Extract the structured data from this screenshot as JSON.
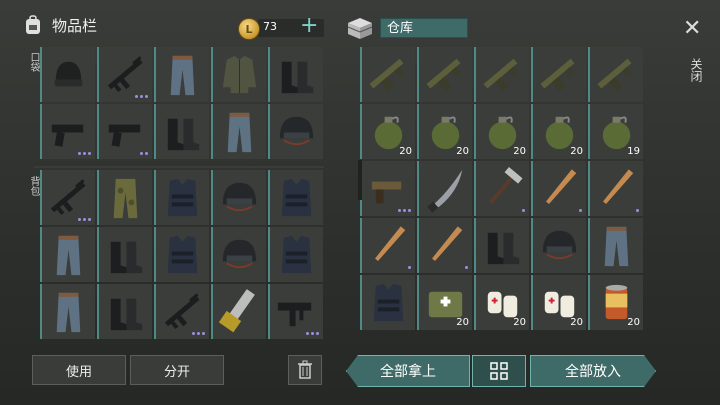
{
  "inventory": {
    "title": "物品栏",
    "pocket_label": "口袋",
    "backpack_label": "背包"
  },
  "currency": {
    "icon": "coin-icon",
    "symbol": "L",
    "amount": "73"
  },
  "storage": {
    "title": "仓库"
  },
  "close": {
    "label": "关闭"
  },
  "buttons": {
    "use": "使用",
    "split": "分开",
    "take_all": "全部拿上",
    "put_all": "全部放入"
  },
  "pockets": [
    {
      "icon": "beanie-icon"
    },
    {
      "icon": "rifle-icon",
      "dots": 3
    },
    {
      "icon": "pants-icon"
    },
    {
      "icon": "jacket-icon"
    },
    {
      "icon": "boots-icon"
    },
    {
      "icon": "pistol-icon",
      "dots": 3
    },
    {
      "icon": "pistol-icon",
      "dots": 2
    },
    {
      "icon": "boots-icon"
    },
    {
      "icon": "pants-icon"
    },
    {
      "icon": "helmet-icon"
    }
  ],
  "backpack": [
    {
      "icon": "rifle-icon",
      "dots": 3
    },
    {
      "icon": "camo-pants-icon"
    },
    {
      "icon": "vest-icon"
    },
    {
      "icon": "helmet-icon"
    },
    {
      "icon": "vest-icon"
    },
    {
      "icon": "pants-icon"
    },
    {
      "icon": "boots-icon"
    },
    {
      "icon": "vest-icon"
    },
    {
      "icon": "helmet-icon"
    },
    {
      "icon": "vest-icon"
    },
    {
      "icon": "pants-icon"
    },
    {
      "icon": "boots-icon"
    },
    {
      "icon": "rifle-icon",
      "dots": 3
    },
    {
      "icon": "chainsaw-icon"
    },
    {
      "icon": "smg-icon",
      "dots": 3
    }
  ],
  "storage_items": [
    {
      "icon": "grenade-launcher-icon"
    },
    {
      "icon": "grenade-launcher-icon"
    },
    {
      "icon": "grenade-launcher-icon"
    },
    {
      "icon": "grenade-launcher-icon"
    },
    {
      "icon": "grenade-launcher-icon"
    },
    {
      "icon": "grenade-icon",
      "count": "20"
    },
    {
      "icon": "grenade-icon",
      "count": "20"
    },
    {
      "icon": "grenade-icon",
      "count": "20"
    },
    {
      "icon": "grenade-icon",
      "count": "20"
    },
    {
      "icon": "grenade-icon",
      "count": "19"
    },
    {
      "icon": "flare-gun-icon",
      "dots": 3
    },
    {
      "icon": "machete-icon"
    },
    {
      "icon": "hammer-icon",
      "dots": 1
    },
    {
      "icon": "bat-icon",
      "dots": 1
    },
    {
      "icon": "bat-icon",
      "dots": 1
    },
    {
      "icon": "bat-icon",
      "dots": 1
    },
    {
      "icon": "bat-icon",
      "dots": 1
    },
    {
      "icon": "boots-icon"
    },
    {
      "icon": "helmet-icon"
    },
    {
      "icon": "pants-icon"
    },
    {
      "icon": "vest-icon"
    },
    {
      "icon": "medkit-icon",
      "count": "20"
    },
    {
      "icon": "bandage-icon",
      "count": "20"
    },
    {
      "icon": "bandage-icon",
      "count": "20"
    },
    {
      "icon": "canned-food-icon",
      "count": "20"
    }
  ],
  "colors": {
    "accent": "#4f8a86",
    "dot": "#9b8fe0",
    "button_teal": "#3e6b68"
  }
}
